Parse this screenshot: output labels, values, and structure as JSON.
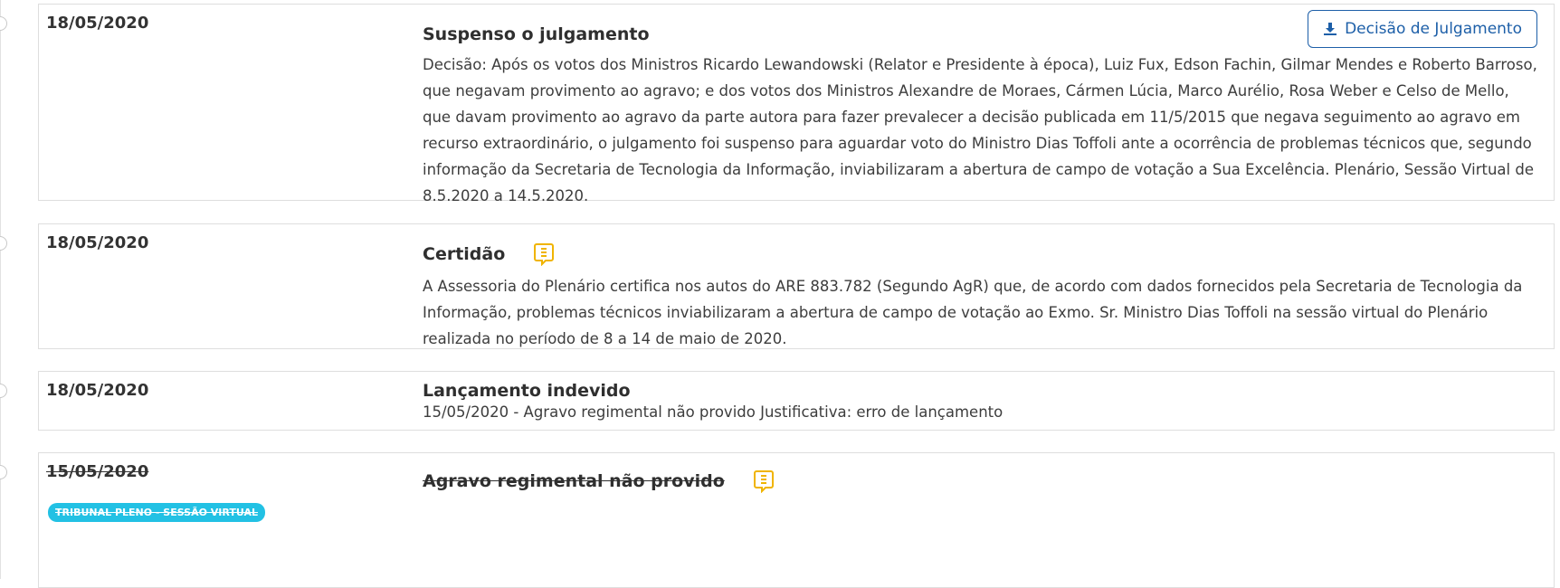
{
  "entries": [
    {
      "date": "18/05/2020",
      "title": "Suspenso o julgamento",
      "button_label": "Decisão de Julgamento",
      "description": "Decisão: Após os votos dos Ministros Ricardo Lewandowski (Relator e Presidente à época), Luiz Fux, Edson Fachin, Gilmar Mendes e Roberto Barroso, que negavam provimento ao agravo; e dos votos dos Ministros Alexandre de Moraes, Cármen Lúcia, Marco Aurélio, Rosa Weber e Celso de Mello, que davam provimento ao agravo da parte autora para fazer prevalecer a decisão publicada em 11/5/2015 que negava seguimento ao agravo em recurso extraordinário, o julgamento foi suspenso para aguardar voto do Ministro Dias Toffoli ante a ocorrência de problemas técnicos que, segundo informação da Secretaria de Tecnologia da Informação, inviabilizaram a abertura de campo de votação a Sua Excelência. Plenário, Sessão Virtual de 8.5.2020 a 14.5.2020."
    },
    {
      "date": "18/05/2020",
      "title": "Certidão",
      "icon": "document-icon",
      "description": "A Assessoria do Plenário certifica nos autos do ARE 883.782 (Segundo AgR) que, de acordo com dados fornecidos pela Secretaria de Tecnologia da Informação, problemas técnicos inviabilizaram a abertura de campo de votação ao Exmo. Sr. Ministro Dias Toffoli na sessão virtual do Plenário realizada no período de 8 a 14 de maio de 2020."
    },
    {
      "date": "18/05/2020",
      "title": "Lançamento indevido",
      "description": "15/05/2020 - Agravo regimental não provido Justificativa: erro de lançamento"
    },
    {
      "date": "15/05/2020",
      "title": "Agravo regimental não provido",
      "icon": "document-icon",
      "badge": "TRIBUNAL PLENO - SESSÃO VIRTUAL",
      "struck": true
    }
  ],
  "colors": {
    "button": "#1d5fa8",
    "doc_icon": "#f0b400",
    "badge": "#22c1e4"
  }
}
